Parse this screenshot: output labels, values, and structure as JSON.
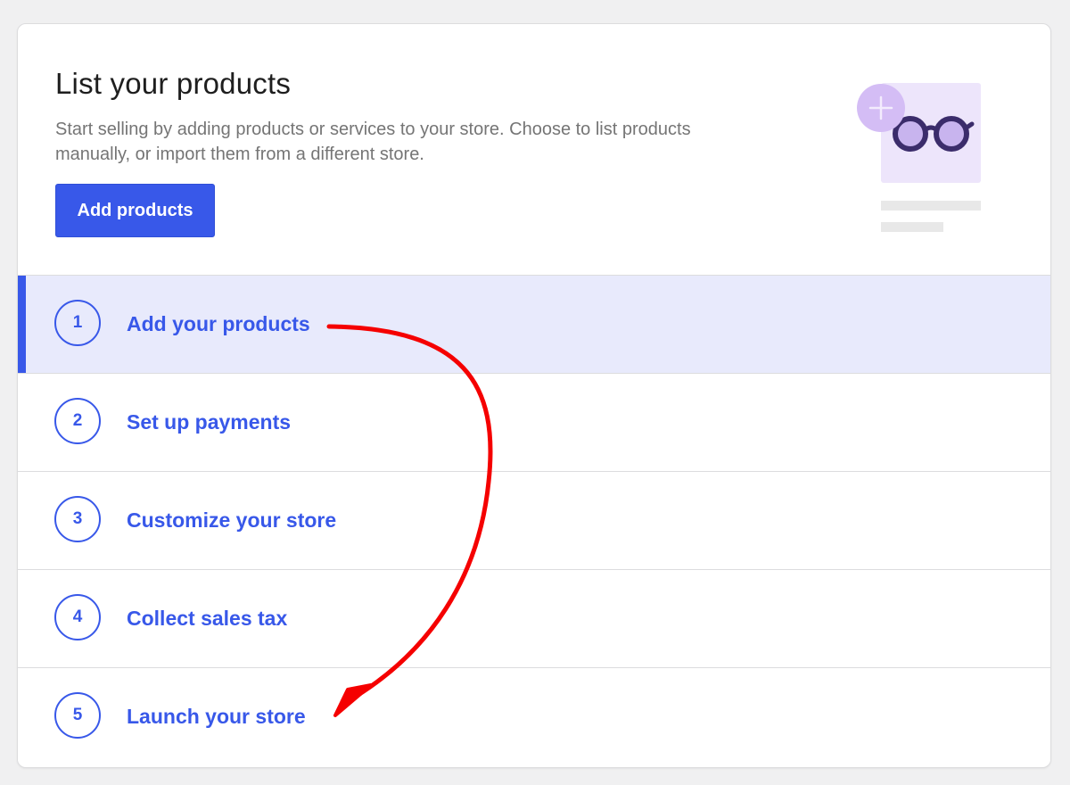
{
  "header": {
    "title": "List your products",
    "description": "Start selling by adding products or services to your store. Choose to list products manually, or import them from a different store.",
    "add_button_label": "Add products"
  },
  "illustration": {
    "icons": [
      "plus-icon",
      "glasses-icon"
    ]
  },
  "steps": [
    {
      "number": "1",
      "label": "Add your products",
      "active": true
    },
    {
      "number": "2",
      "label": "Set up payments",
      "active": false
    },
    {
      "number": "3",
      "label": "Customize your store",
      "active": false
    },
    {
      "number": "4",
      "label": "Collect sales tax",
      "active": false
    },
    {
      "number": "5",
      "label": "Launch your store",
      "active": false
    }
  ],
  "colors": {
    "accent": "#3858e9",
    "active_row_bg": "#e8eafc",
    "annotation_arrow": "#f50000",
    "illustration_bg": "#ede5fb",
    "illustration_plus_circle": "#d4bdf5",
    "glasses": "#3b2c6b"
  }
}
